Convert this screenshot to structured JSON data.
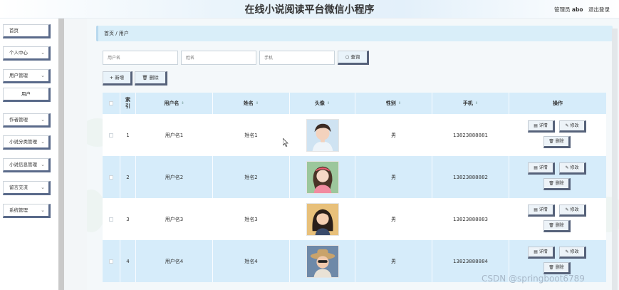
{
  "header": {
    "title": "在线小说阅读平台微信小程序",
    "user_prefix": "管理员",
    "username": "abo",
    "logout": "退出登录"
  },
  "sidebar": {
    "items": [
      {
        "label": "首页",
        "chevron": false
      },
      {
        "label": "个人中心",
        "chevron": true
      },
      {
        "label": "用户管理",
        "chevron": true
      },
      {
        "label": "用户",
        "chevron": false,
        "sub": true
      },
      {
        "label": "作者管理",
        "chevron": true
      },
      {
        "label": "小说分类管理",
        "chevron": true
      },
      {
        "label": "小说信息管理",
        "chevron": true
      },
      {
        "label": "留言交流",
        "chevron": true
      },
      {
        "label": "系统管理",
        "chevron": true
      }
    ]
  },
  "breadcrumb": "首页 / 用户",
  "search": {
    "username_placeholder": "用户名",
    "name_placeholder": "姓名",
    "phone_placeholder": "手机",
    "query_button": "查询"
  },
  "toolbar": {
    "add": "新增",
    "delete": "删除"
  },
  "table": {
    "columns": [
      "",
      "索引",
      "用户名",
      "姓名",
      "头像",
      "性别",
      "手机",
      "操作"
    ],
    "rows": [
      {
        "index": "1",
        "username": "用户名1",
        "name": "姓名1",
        "avatar": "avatar-1",
        "gender": "男",
        "phone": "13823888881"
      },
      {
        "index": "2",
        "username": "用户名2",
        "name": "姓名2",
        "avatar": "avatar-2",
        "gender": "男",
        "phone": "13823888882"
      },
      {
        "index": "3",
        "username": "用户名3",
        "name": "姓名3",
        "avatar": "avatar-3",
        "gender": "男",
        "phone": "13823888883"
      },
      {
        "index": "4",
        "username": "用户名4",
        "name": "姓名4",
        "avatar": "avatar-4",
        "gender": "男",
        "phone": "13823888884"
      }
    ],
    "actions": {
      "detail": "详情",
      "edit": "修改",
      "delete": "删除"
    }
  },
  "watermark": "CSDN @springboot6789",
  "colors": {
    "header_bg": "#e3f0fa",
    "table_head": "#d6ecfa",
    "row_highlight": "#d6ecfa",
    "button_shadow": "#56627a"
  }
}
